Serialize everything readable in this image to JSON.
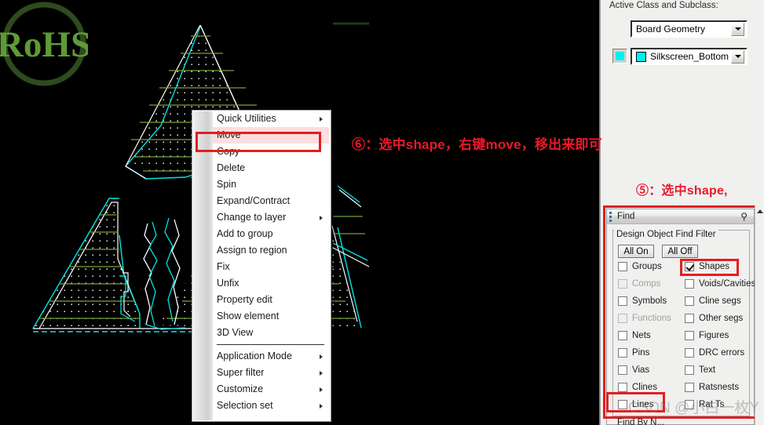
{
  "canvas": {
    "logo": {
      "name": "RoHS",
      "text": "RoHS",
      "ring_color": "#2e4a1e",
      "text_color": "#5f9a36"
    },
    "colors": {
      "background": "#000000",
      "shape_outline": "#00e5e5",
      "shape_edge": "#ffffff",
      "hatch": "#7aa13a",
      "dot_fill": "#ffffff"
    }
  },
  "context_menu": {
    "items": [
      {
        "label": "Quick Utilities",
        "submenu": true,
        "selected": false,
        "separator_after": false
      },
      {
        "label": "Move",
        "submenu": false,
        "selected": true,
        "separator_after": false
      },
      {
        "label": "Copy",
        "submenu": false,
        "selected": false,
        "separator_after": false
      },
      {
        "label": "Delete",
        "submenu": false,
        "selected": false,
        "separator_after": false
      },
      {
        "label": "Spin",
        "submenu": false,
        "selected": false,
        "separator_after": false
      },
      {
        "label": "Expand/Contract",
        "submenu": false,
        "selected": false,
        "separator_after": false
      },
      {
        "label": "Change to layer",
        "submenu": true,
        "selected": false,
        "separator_after": false
      },
      {
        "label": "Add to group",
        "submenu": false,
        "selected": false,
        "separator_after": false
      },
      {
        "label": "Assign to region",
        "submenu": false,
        "selected": false,
        "separator_after": false
      },
      {
        "label": "Fix",
        "submenu": false,
        "selected": false,
        "separator_after": false
      },
      {
        "label": "Unfix",
        "submenu": false,
        "selected": false,
        "separator_after": false
      },
      {
        "label": "Property edit",
        "submenu": false,
        "selected": false,
        "separator_after": false
      },
      {
        "label": "Show element",
        "submenu": false,
        "selected": false,
        "separator_after": false
      },
      {
        "label": "3D View",
        "submenu": false,
        "selected": false,
        "separator_after": true
      },
      {
        "label": "Application Mode",
        "submenu": true,
        "selected": false,
        "separator_after": false
      },
      {
        "label": "Super filter",
        "submenu": true,
        "selected": false,
        "separator_after": false
      },
      {
        "label": "Customize",
        "submenu": true,
        "selected": false,
        "separator_after": false
      },
      {
        "label": "Selection set",
        "submenu": true,
        "selected": false,
        "separator_after": false
      }
    ]
  },
  "right_panel": {
    "active_class_label": "Active Class and Subclass:",
    "class_value": "Board Geometry",
    "subclass_value": "Silkscreen_Bottom",
    "subclass_color": "#00f0f0"
  },
  "annotations": {
    "step6": "⑥：选中shape，右键move，移出来即可",
    "step5": "⑤：选中shape,",
    "color": "#e8192c"
  },
  "find_dialog": {
    "title": "Find",
    "pin_icon": "pin-icon",
    "group_legend": "Design Object Find Filter",
    "buttons": {
      "all_on": "All On",
      "all_off": "All Off"
    },
    "find_by_name_label": "Find By N...",
    "checkboxes_left": [
      {
        "label": "Groups",
        "checked": false,
        "disabled": false,
        "highlighted": false
      },
      {
        "label": "Comps",
        "checked": false,
        "disabled": true,
        "highlighted": false
      },
      {
        "label": "Symbols",
        "checked": false,
        "disabled": false,
        "highlighted": false
      },
      {
        "label": "Functions",
        "checked": false,
        "disabled": true,
        "highlighted": false
      },
      {
        "label": "Nets",
        "checked": false,
        "disabled": false,
        "highlighted": false
      },
      {
        "label": "Pins",
        "checked": false,
        "disabled": false,
        "highlighted": false
      },
      {
        "label": "Vias",
        "checked": false,
        "disabled": false,
        "highlighted": false
      },
      {
        "label": "Clines",
        "checked": false,
        "disabled": false,
        "highlighted": false
      },
      {
        "label": "Lines",
        "checked": false,
        "disabled": false,
        "highlighted": true
      }
    ],
    "checkboxes_right": [
      {
        "label": "Shapes",
        "checked": true,
        "disabled": false,
        "highlighted": true
      },
      {
        "label": "Voids/Cavities",
        "checked": false,
        "disabled": false,
        "highlighted": false
      },
      {
        "label": "Cline segs",
        "checked": false,
        "disabled": false,
        "highlighted": false
      },
      {
        "label": "Other segs",
        "checked": false,
        "disabled": false,
        "highlighted": false
      },
      {
        "label": "Figures",
        "checked": false,
        "disabled": false,
        "highlighted": false
      },
      {
        "label": "DRC errors",
        "checked": false,
        "disabled": false,
        "highlighted": false
      },
      {
        "label": "Text",
        "checked": false,
        "disabled": false,
        "highlighted": false
      },
      {
        "label": "Ratsnests",
        "checked": false,
        "disabled": false,
        "highlighted": false
      },
      {
        "label": "Rat Ts",
        "checked": false,
        "disabled": false,
        "highlighted": false
      }
    ]
  },
  "watermark": {
    "text": "CSDN @小白一枚Y"
  }
}
